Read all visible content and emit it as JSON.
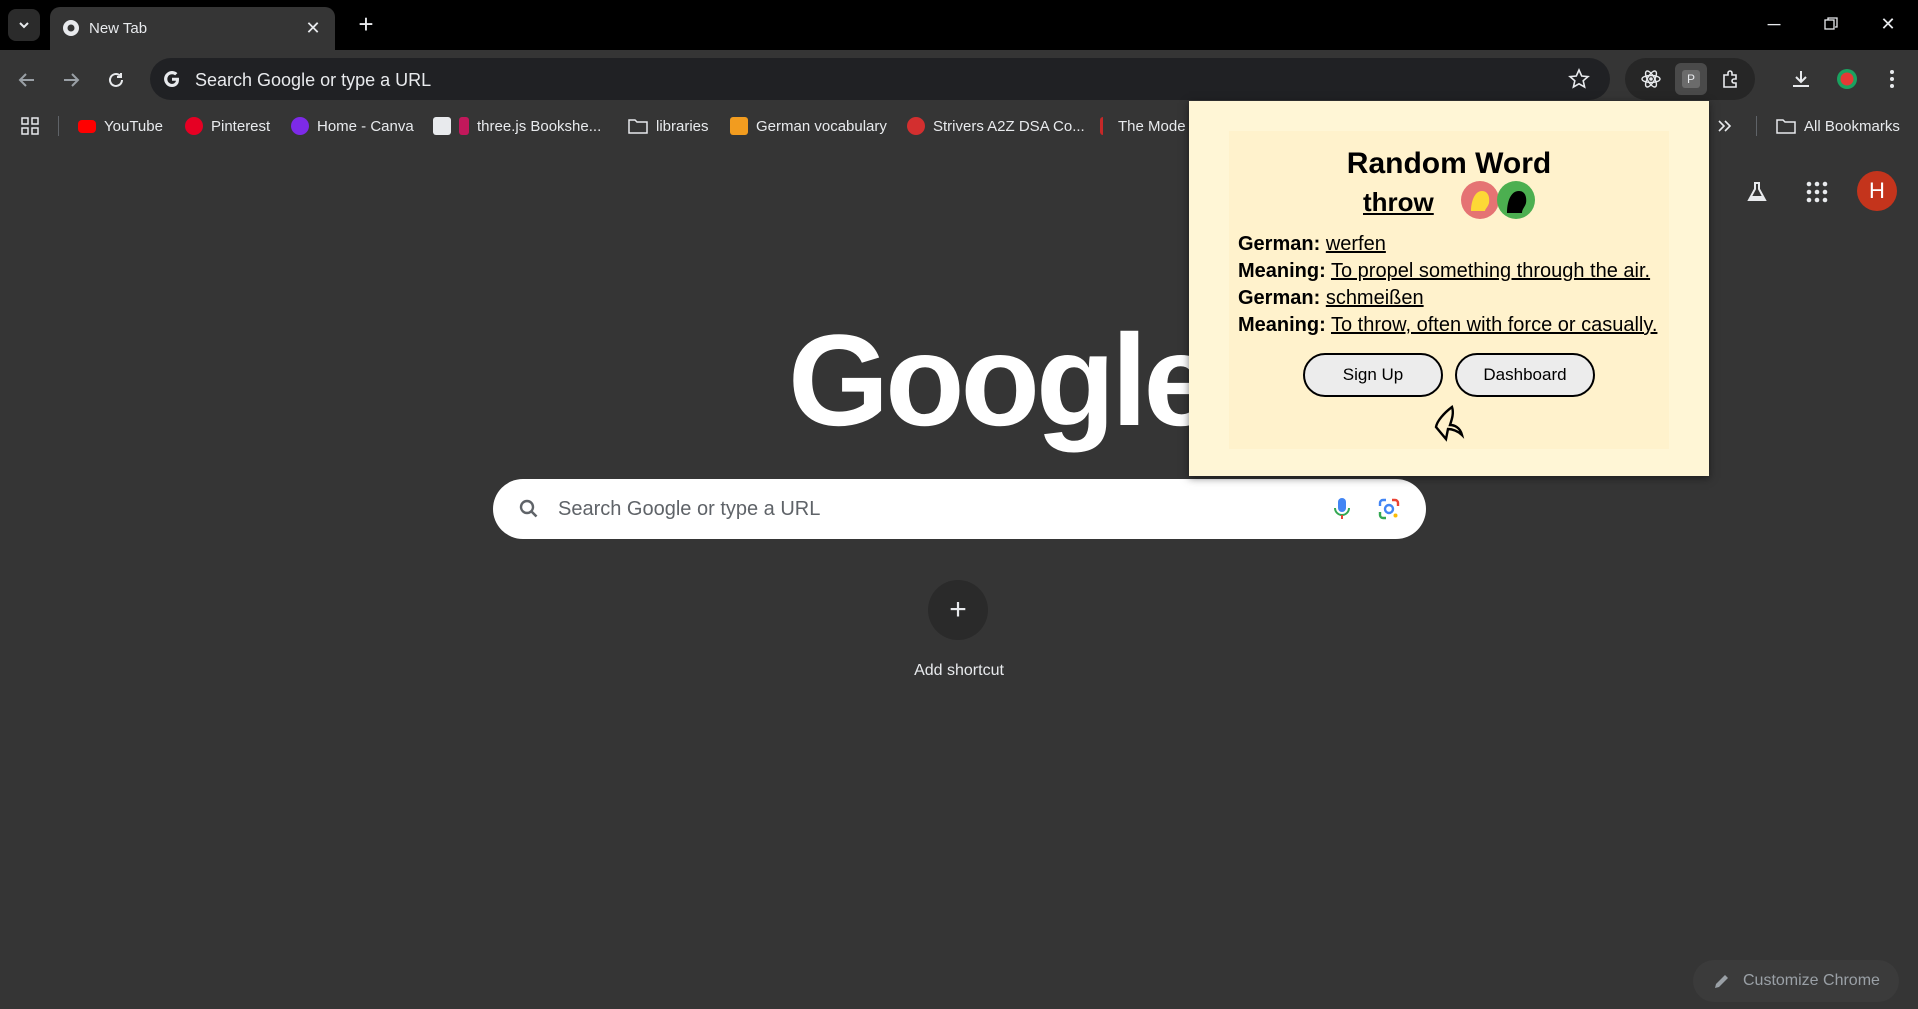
{
  "tab": {
    "title": "New Tab"
  },
  "omnibox": {
    "placeholder": "Search Google or type a URL"
  },
  "bookmarks": [
    {
      "label": "YouTube",
      "color": "#ff0000"
    },
    {
      "label": "Pinterest",
      "color": "#e60023"
    },
    {
      "label": "Home - Canva",
      "color": "#7d2ae8"
    },
    {
      "label": "three.js Bookshe...",
      "color": "#c2185b"
    },
    {
      "label": "libraries",
      "color": ""
    },
    {
      "label": "German vocabulary",
      "color": "#f29c1f"
    },
    {
      "label": "Strivers A2Z DSA Co...",
      "color": "#d32f2f"
    },
    {
      "label": "The Mode",
      "color": "#c62828"
    }
  ],
  "all_bookmarks": "All Bookmarks",
  "ntp": {
    "logo": "Google",
    "search_placeholder": "Search Google or type a URL",
    "add_shortcut": "Add shortcut",
    "customize": "Customize Chrome"
  },
  "profile": {
    "initial": "H",
    "color": "#c4341c"
  },
  "popup": {
    "title": "Random Word",
    "word": "throw",
    "entries": [
      {
        "label": "German:",
        "value": "werfen"
      },
      {
        "label": "Meaning:",
        "value": "To propel something through the air."
      },
      {
        "label": "German:",
        "value": "schmeißen"
      },
      {
        "label": "Meaning:",
        "value": "To throw, often with force or casually."
      }
    ],
    "signup_label": "Sign Up",
    "dashboard_label": "Dashboard"
  }
}
